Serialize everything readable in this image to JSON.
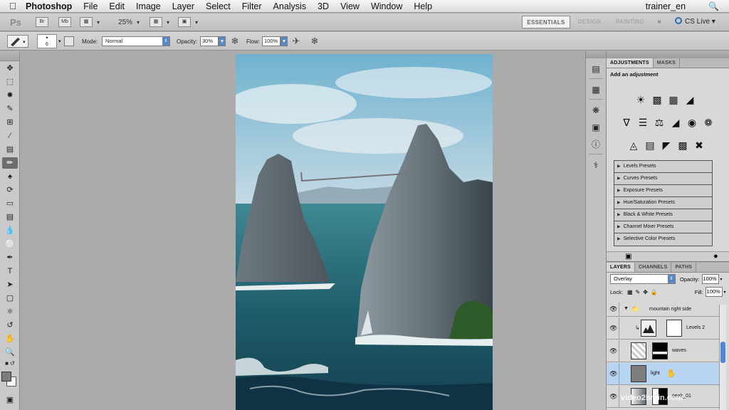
{
  "menubar": {
    "apple": "",
    "app": "Photoshop",
    "items": [
      "File",
      "Edit",
      "Image",
      "Layer",
      "Select",
      "Filter",
      "Analysis",
      "3D",
      "View",
      "Window",
      "Help"
    ],
    "user": "trainer_en"
  },
  "appbar": {
    "logo": "Ps",
    "btn_bridge": "Br",
    "btn_minibridge": "Mb",
    "zoom": "25%",
    "workspaces": [
      "ESSENTIALS",
      "DESIGN",
      "PAINTING"
    ],
    "more": "»",
    "cslive": "CS Live"
  },
  "options": {
    "brush_size": "6",
    "mode_label": "Mode:",
    "mode_value": "Normal",
    "opacity_label": "Opacity:",
    "opacity_value": "30%",
    "flow_label": "Flow:",
    "flow_value": "100%"
  },
  "adjustments": {
    "tabs": [
      "ADJUSTMENTS",
      "MASKS"
    ],
    "title": "Add an adjustment",
    "presets": [
      "Levels Presets",
      "Curves Presets",
      "Exposure Presets",
      "Hue/Saturation Presets",
      "Black & White Presets",
      "Channel Mixer Presets",
      "Selective Color Presets"
    ]
  },
  "layers": {
    "tabs": [
      "LAYERS",
      "CHANNELS",
      "PATHS"
    ],
    "blend_mode": "Overlay",
    "opacity_label": "Opacity:",
    "opacity_value": "100%",
    "lock_label": "Lock:",
    "fill_label": "Fill:",
    "fill_value": "100%",
    "rows": [
      {
        "name": "mountain right side"
      },
      {
        "name": "Levels 2"
      },
      {
        "name": "waves"
      },
      {
        "name": "light"
      },
      {
        "name": "peak_01"
      }
    ]
  },
  "watermark": "video2brain.com"
}
